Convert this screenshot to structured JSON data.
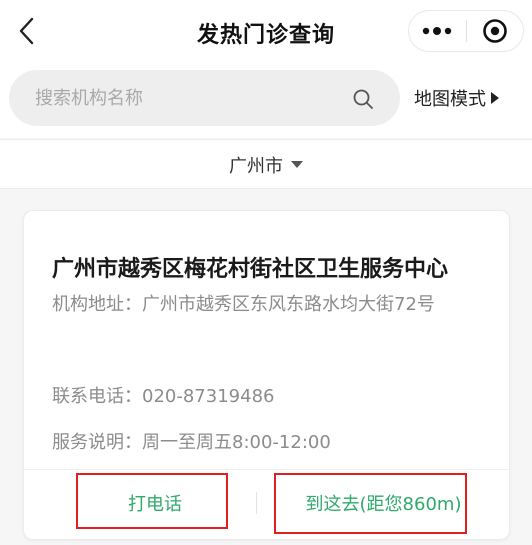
{
  "navbar": {
    "title": "发热门诊查询",
    "back_icon": "chevron-left-icon",
    "more_icon": "more-dots-icon",
    "close_icon": "target-close-icon"
  },
  "search": {
    "placeholder": "搜索机构名称",
    "value": "",
    "icon": "search-icon",
    "map_mode_label": "地图模式",
    "map_mode_icon": "triangle-right-icon"
  },
  "city_selector": {
    "selected": "广州市",
    "icon": "caret-down-icon"
  },
  "results": [
    {
      "name": "广州市越秀区梅花村街社区卫生服务中心",
      "address_label": "机构地址：",
      "address": "广州市越秀区东风东路水均大街72号",
      "phone_label": "联系电话：",
      "phone": "020-87319486",
      "service_label": "服务说明：",
      "service": "周一至周五8:00-12:00",
      "call_label": "打电话",
      "navigate_label": "到这去(距您860m)"
    }
  ],
  "colors": {
    "accent_green": "#2faa6b",
    "highlight_red": "#e02020",
    "page_background": "#f6f6f6"
  }
}
